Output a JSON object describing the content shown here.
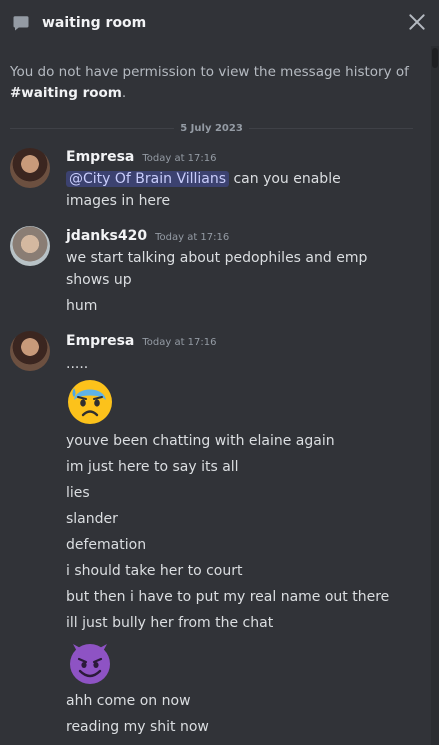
{
  "header": {
    "title": "waiting room",
    "channel_icon": "chat-bubble-icon",
    "close_icon": "close-icon"
  },
  "notice": {
    "text": "You do not have permission to view the message history of",
    "channel": "#waiting room",
    "period": "."
  },
  "divider": {
    "date": "5 July 2023"
  },
  "messages": [
    {
      "author": "Empresa",
      "time": "Today at 17:16",
      "mention": "@City Of Brain Villians",
      "lines": [
        "can you enable",
        "images in here"
      ]
    },
    {
      "author": "jdanks420",
      "time": "Today at 17:16",
      "lines": [
        "we start talking about pedophiles and emp",
        "shows up",
        "hum"
      ]
    },
    {
      "author": "Empresa",
      "time": "Today at 17:16",
      "lines": [
        ".....",
        "youve been chatting with elaine again",
        "im just here to say its all",
        "lies",
        "slander",
        "defemation",
        "i should take her to court",
        "but then i have to put my real name out there",
        "ill just bully her from the chat",
        "ahh come on now",
        "reading my shit now"
      ],
      "emojis": [
        "anxious-sweat-face-emoji",
        "smiling-devil-emoji"
      ]
    }
  ],
  "colors": {
    "background": "#313338",
    "mention_bg": "#3c4270",
    "mention_text": "#c9cdfb",
    "emoji_yellow": "#fcc21b",
    "emoji_purple": "#8e53c4"
  }
}
